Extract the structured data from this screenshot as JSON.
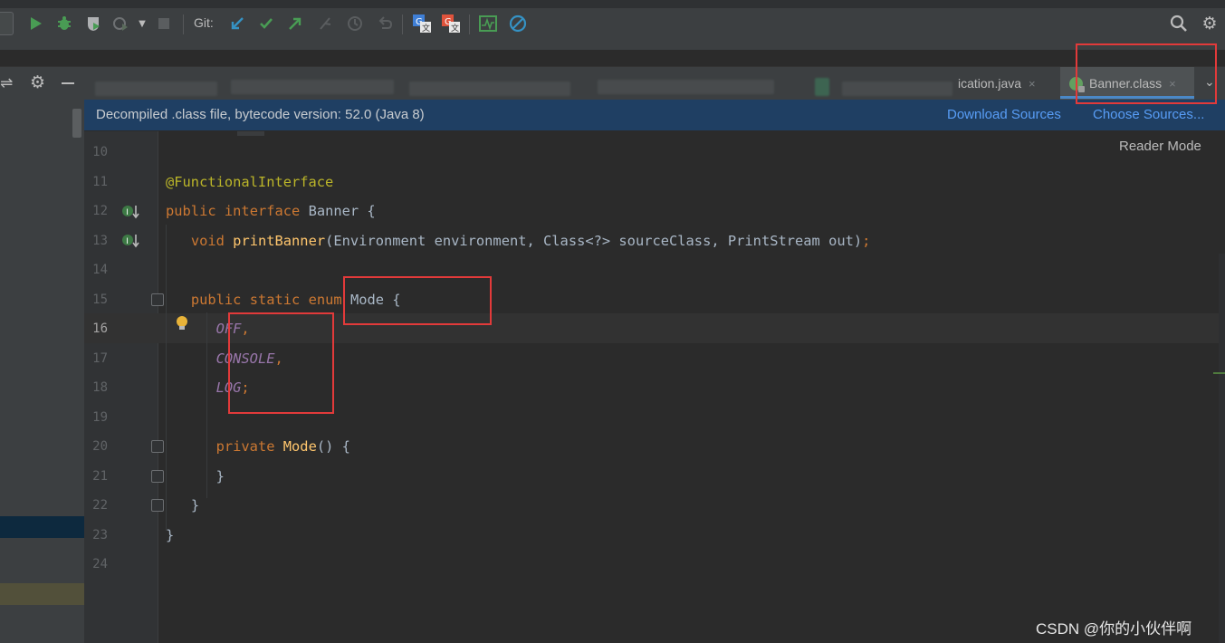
{
  "toolbar": {
    "git_label": "Git:",
    "icons": [
      "run-icon",
      "debug-icon",
      "coverage-icon",
      "profile-icon",
      "dropdown-icon",
      "stop-icon",
      "git-update-icon",
      "git-commit-icon",
      "git-push-icon",
      "git-merge-icon",
      "git-history-icon",
      "git-rollback-icon",
      "translate-icon",
      "translate-alt-icon",
      "activity-monitor-icon",
      "no-entry-icon",
      "search-icon",
      "settings-icon"
    ]
  },
  "tabs": {
    "partial_label": "ication.java",
    "active_label": "Banner.class",
    "close_glyph": "×"
  },
  "banner": {
    "text": "Decompiled .class file, bytecode version: 52.0 (Java 8)",
    "download_sources": "Download Sources",
    "choose_sources": "Choose Sources..."
  },
  "editor": {
    "reader_mode": "Reader Mode",
    "line_numbers": [
      "10",
      "11",
      "12",
      "13",
      "14",
      "15",
      "16",
      "17",
      "18",
      "19",
      "20",
      "21",
      "22",
      "23",
      "24"
    ],
    "current_line": "16",
    "code": {
      "annotation": "@FunctionalInterface",
      "l12_public": "public",
      "l12_interface": "interface",
      "l12_rest": " Banner {",
      "l13_void": "void",
      "l13_fn": "printBanner",
      "l13_rest": "(Environment environment, Class<?> sourceClass, PrintStream out)",
      "l13_semi": ";",
      "l15_public": "public",
      "l15_static": "static",
      "l15_enum": "enum",
      "l15_rest": " Mode {",
      "l16_const": "OFF",
      "l17_const": "CONSOLE",
      "l18_const": "LOG",
      "comma": ",",
      "semi": ";",
      "l20_private": "private",
      "l20_fn": "Mode",
      "l20_rest": "() {",
      "close_brace": "}"
    }
  },
  "watermark": "CSDN @你的小伙伴啊"
}
